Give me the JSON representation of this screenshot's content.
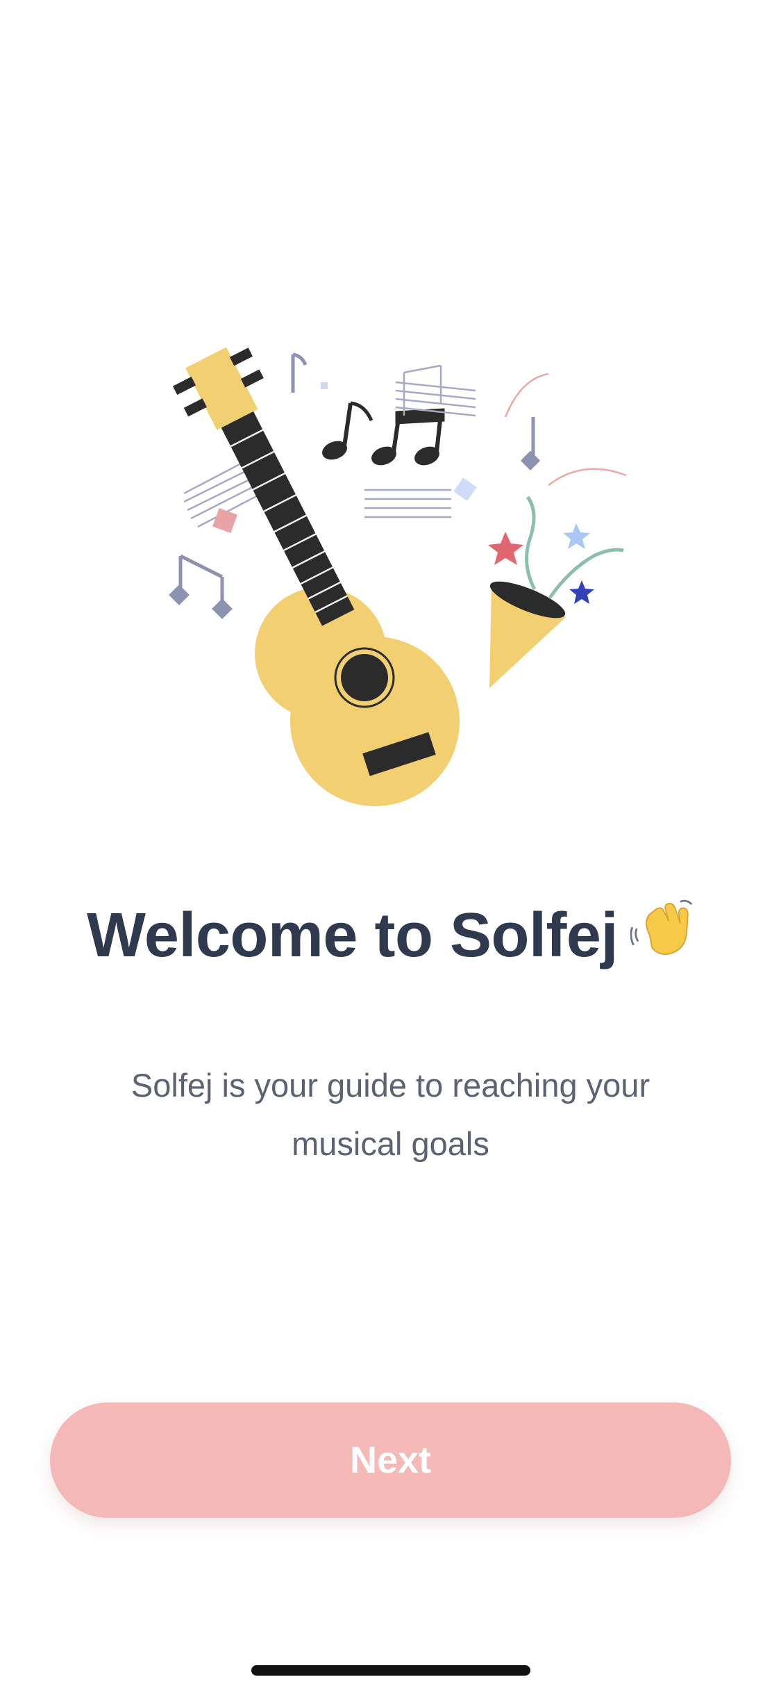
{
  "onboarding": {
    "title": "Welcome to Solfej",
    "title_emoji": "waving-hand-icon",
    "subtitle": "Solfej is your guide to reaching your musical goals",
    "next_label": "Next"
  },
  "illustration": {
    "icons": [
      "guitar-icon",
      "music-notes-icon",
      "party-popper-icon"
    ]
  },
  "colors": {
    "background": "#ffffff",
    "title": "#2f3a4f",
    "subtitle": "#5b6272",
    "button": "#f4b8b6",
    "button_text": "#ffffff",
    "guitar": "#f2d072",
    "dark": "#2b2b2b"
  }
}
